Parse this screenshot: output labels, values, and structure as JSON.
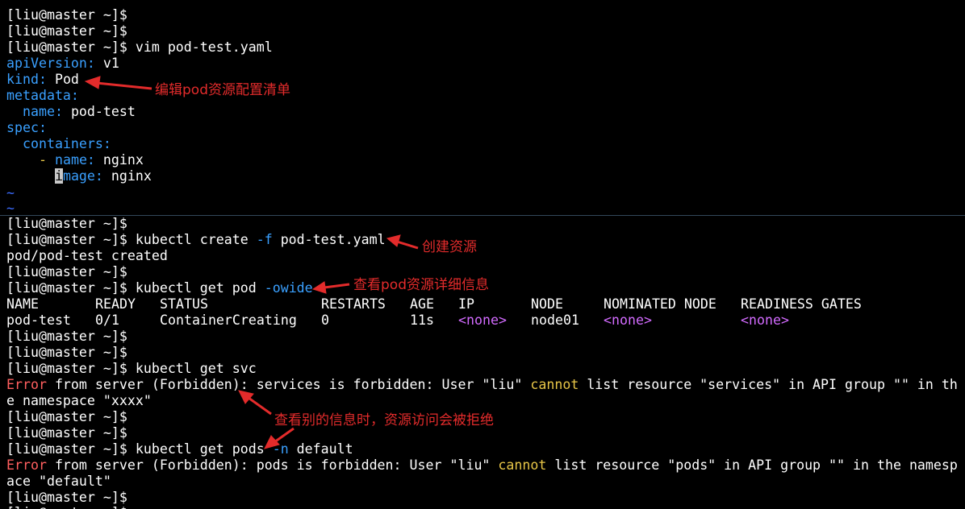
{
  "prompt": "[liu@master ~]$",
  "vim": {
    "command": "vim pod-test.yaml",
    "yaml": {
      "apiVersion_key": "apiVersion:",
      "apiVersion_val": "v1",
      "kind_key": "kind:",
      "kind_val": "Pod",
      "metadata_key": "metadata:",
      "name_key": "name:",
      "name_val": "pod-test",
      "spec_key": "spec:",
      "containers_key": "containers:",
      "dash": "-",
      "container_name_key": "name:",
      "container_name_val": "nginx",
      "image_cursor": "i",
      "image_key_rest": "mage:",
      "image_val": "nginx"
    },
    "tilde": "~"
  },
  "session": {
    "create_cmd": "kubectl create ",
    "create_flag": "-f",
    "create_arg": " pod-test.yaml",
    "create_output": "pod/pod-test created",
    "get_pod_cmd": "kubectl get pod ",
    "get_pod_flag": "-owide",
    "table": {
      "headers": [
        "NAME",
        "READY",
        "STATUS",
        "RESTARTS",
        "AGE",
        "IP",
        "NODE",
        "NOMINATED NODE",
        "READINESS GATES"
      ],
      "row": {
        "name": "pod-test",
        "ready": "0/1",
        "status": "ContainerCreating",
        "restarts": "0",
        "age": "11s",
        "ip": "<none>",
        "node": "node01",
        "nominated": "<none>",
        "readiness": "<none>"
      }
    },
    "get_svc_cmd": "kubectl get svc",
    "error_word": "Error",
    "cannot_word": "cannot",
    "svc_err_part1": " from server (Forbidden): services is forbidden: User \"liu\" ",
    "svc_err_part2": " list resource \"services\" in API group \"\" in th",
    "svc_err_line2": "e namespace \"xxxx\"",
    "get_pods_cmd": "kubectl get pods ",
    "get_pods_flag": "-n",
    "get_pods_arg": " default",
    "pods_err_part1": " from server (Forbidden): pods is forbidden: User \"liu\" ",
    "pods_err_part2": " list resource \"pods\" in API group \"\" in the namesp",
    "pods_err_line2": "ace \"default\""
  },
  "annotations": {
    "edit": "编辑pod资源配置清单",
    "create": "创建资源",
    "detail": "查看pod资源详细信息",
    "denied": "查看别的信息时，资源访问会被拒绝"
  },
  "colors": {
    "background": "#000000",
    "text": "#ffffff",
    "yaml_key": "#3aa0ff",
    "yaml_dash": "#e7c547",
    "error": "#ff5f5f",
    "cannot": "#e7c547",
    "none": "#d36bff",
    "annotation": "#e32b2b"
  }
}
